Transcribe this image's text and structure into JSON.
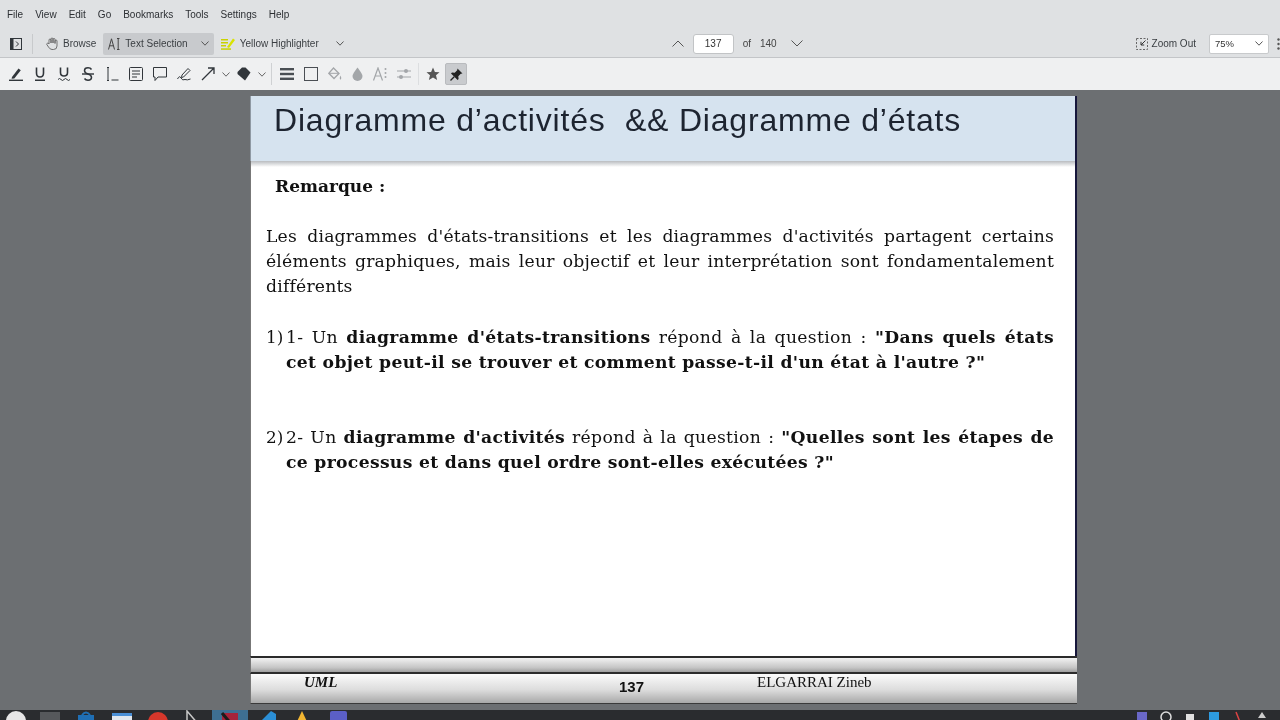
{
  "menu_bar": {
    "items": [
      "File",
      "View",
      "Edit",
      "Go",
      "Bookmarks",
      "Tools",
      "Settings",
      "Help"
    ]
  },
  "main_toolbar": {
    "tools": [
      {
        "kind": "browse",
        "label": "Browse",
        "selected": false
      },
      {
        "kind": "text_selection",
        "label": "Text Selection",
        "selected": true
      },
      {
        "kind": "highlighter",
        "label": "Yellow Highlighter",
        "selected": false
      }
    ],
    "page_navigation": {
      "page_field": {
        "value": "137"
      },
      "of_label": "of",
      "page_count": "140"
    },
    "zoom_out_button": {
      "label": "Zoom Out"
    },
    "zoom_combo": {
      "value": "75%"
    }
  },
  "annotation_toolbar": {
    "style_controls": [
      {
        "disabled": false
      },
      {
        "disabled": false
      },
      {
        "disabled": true
      },
      {
        "disabled": true
      },
      {
        "disabled": true
      },
      {
        "disabled": true
      }
    ],
    "pin": {
      "on": true
    }
  },
  "document": {
    "title": "Diagramme d’activités  && Diagramme d’états",
    "heading": "Remarque :",
    "intro": "Les diagrammes d'états-transitions et les diagrammes d'activités partagent certains éléments graphiques, mais leur objectif et leur interprétation sont fondamentalement différents",
    "items": [
      {
        "number": "1)",
        "text": "1- Un **diagramme d'états-transitions** répond à la question : **\"Dans quels états cet objet peut-il se trouver et comment passe-t-il d'un état à l'autre ?\"**"
      },
      {
        "number": "2)",
        "text": "2- Un **diagramme d'activités** répond à la question : **\"Quelles sont les étapes de ce processus et dans quel ordre sont-elles exécutées ?\"**"
      }
    ],
    "footer": {
      "left": "UML",
      "page_number": "137",
      "right": "ELGARRAI Zineb"
    }
  }
}
